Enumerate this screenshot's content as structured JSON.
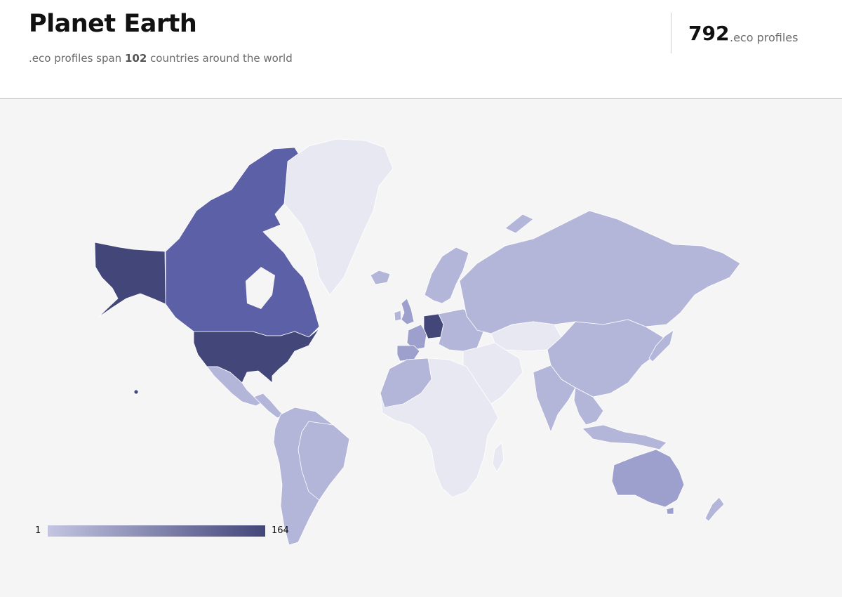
{
  "header": {
    "title": "Planet Earth",
    "subtitle_prefix": ".eco profiles span ",
    "country_count": "102",
    "subtitle_suffix": " countries around the world",
    "profile_count": "792",
    "profile_label": ".eco profiles"
  },
  "legend": {
    "min": "1",
    "max": "164",
    "color_min": "#c3c5e2",
    "color_max": "#434679"
  },
  "colors": {
    "background": "#f5f5f5",
    "no_data": "#e8e8f2",
    "low": "#b4b6d9",
    "mid": "#9d9fcd",
    "high": "#5c60a7",
    "highest": "#434679"
  },
  "countries": [
    {
      "name": "United States",
      "level": "highest"
    },
    {
      "name": "Alaska (United States)",
      "level": "highest"
    },
    {
      "name": "Canada",
      "level": "high"
    },
    {
      "name": "Germany",
      "level": "highest"
    },
    {
      "name": "Greenland",
      "level": "no_data"
    },
    {
      "name": "Russia",
      "level": "low"
    },
    {
      "name": "China",
      "level": "low"
    },
    {
      "name": "Australia",
      "level": "mid"
    },
    {
      "name": "Brazil",
      "level": "low"
    },
    {
      "name": "Spain",
      "level": "mid"
    },
    {
      "name": "France",
      "level": "mid"
    },
    {
      "name": "United Kingdom",
      "level": "mid"
    },
    {
      "name": "India",
      "level": "low"
    },
    {
      "name": "Mexico",
      "level": "low"
    },
    {
      "name": "Kazakhstan",
      "level": "no_data"
    }
  ]
}
